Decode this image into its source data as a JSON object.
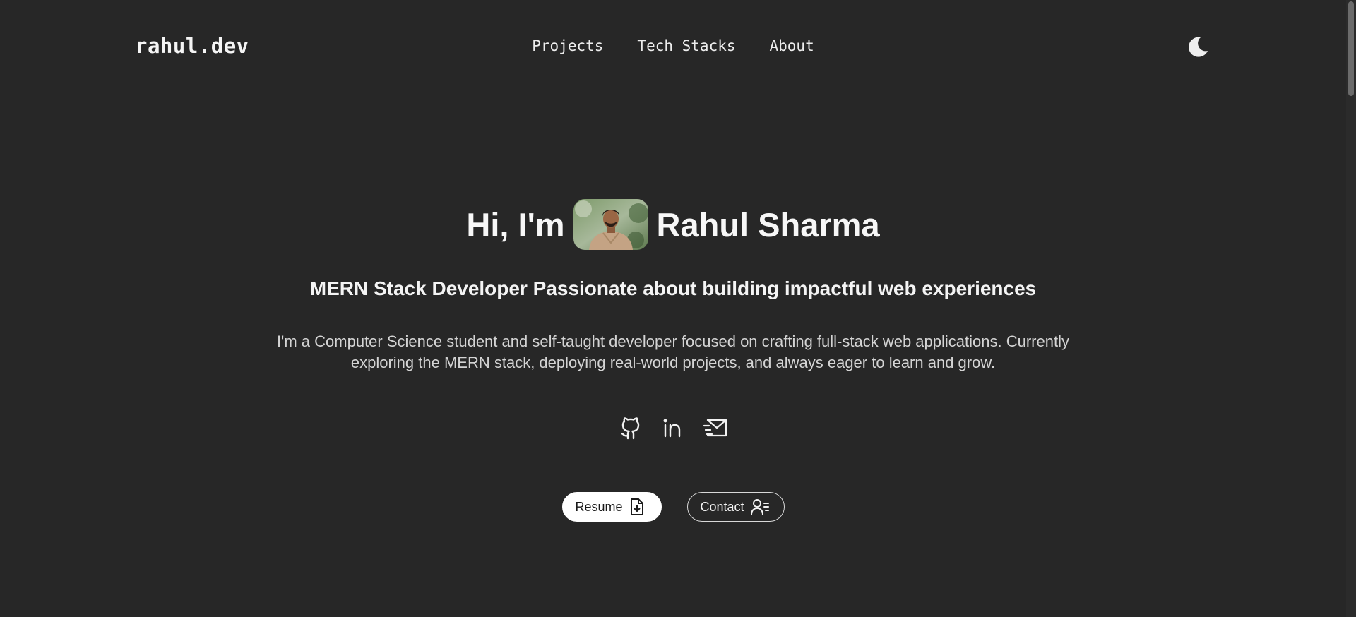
{
  "header": {
    "logo": "rahul.dev",
    "nav": [
      {
        "label": "Projects"
      },
      {
        "label": "Tech Stacks"
      },
      {
        "label": "About"
      }
    ],
    "theme_toggle_icon": "moon-icon"
  },
  "hero": {
    "greeting": "Hi, I'm",
    "name": "Rahul Sharma",
    "avatar_icon": "profile-photo",
    "tagline": "MERN Stack Developer Passionate about building impactful web experiences",
    "bio": "I'm a Computer Science student and self-taught developer focused on crafting full-stack web applications. Currently exploring the MERN stack, deploying real-world projects, and always eager to learn and grow."
  },
  "socials": [
    {
      "icon": "github-icon"
    },
    {
      "icon": "linkedin-icon"
    },
    {
      "icon": "email-icon"
    }
  ],
  "actions": {
    "resume_label": "Resume",
    "contact_label": "Contact"
  },
  "colors": {
    "background": "#272727",
    "text": "#f2f2f2",
    "button_light": "#ffffff"
  }
}
